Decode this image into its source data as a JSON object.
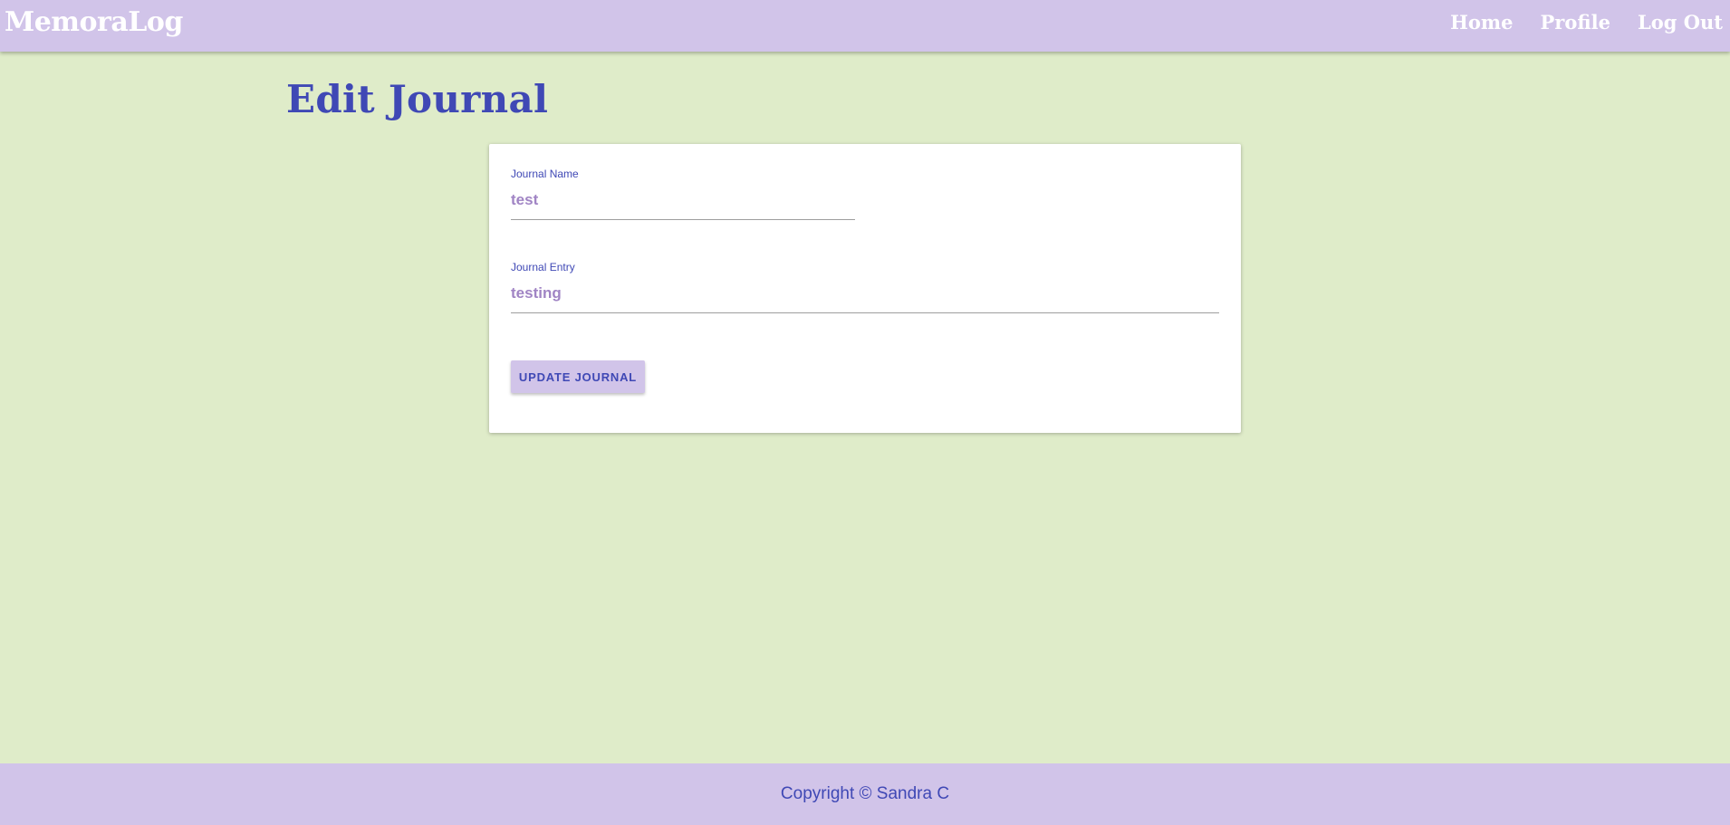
{
  "header": {
    "brand": "MemoraLog",
    "nav": [
      {
        "label": "Home"
      },
      {
        "label": "Profile"
      },
      {
        "label": "Log Out"
      }
    ]
  },
  "page": {
    "title": "Edit Journal"
  },
  "form": {
    "journal_name": {
      "label": "Journal Name",
      "value": "test"
    },
    "journal_entry": {
      "label": "Journal Entry",
      "value": "testing"
    },
    "submit_label": "UPDATE JOURNAL"
  },
  "footer": {
    "text": "Copyright © Sandra C"
  },
  "colors": {
    "background": "#dfecc9",
    "header_footer": "#d1c4e9",
    "accent_text": "#3f48b5",
    "input_text": "#a084c4"
  }
}
